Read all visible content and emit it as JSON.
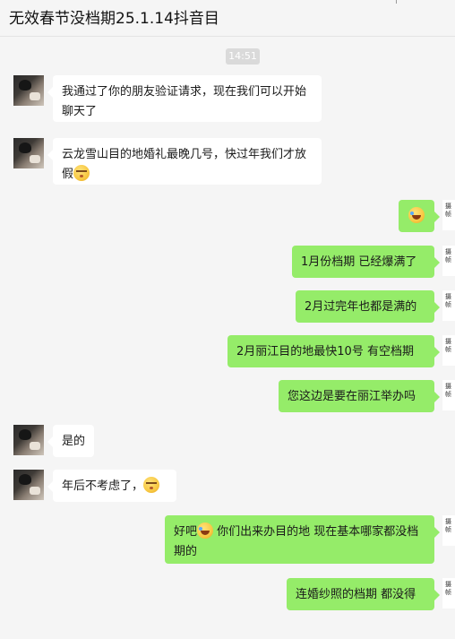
{
  "chat": {
    "title": "无效春节没档期25.1.14抖音目"
  },
  "timestamp": "14:51",
  "self_avatar_text": "摄\n帧",
  "messages": [
    {
      "side": "left",
      "text": "我通过了你的朋友验证请求，现在我们可以开始聊天了"
    },
    {
      "side": "left",
      "text": "云龙雪山目的地婚礼最晚几号，快过年我们才放假",
      "emoji": "shy"
    },
    {
      "side": "right",
      "emoji": "laugh"
    },
    {
      "side": "right",
      "text": "1月份档期 已经爆满了"
    },
    {
      "side": "right",
      "text": "2月过完年也都是满的"
    },
    {
      "side": "right",
      "text": "2月丽江目的地最快10号 有空档期"
    },
    {
      "side": "right",
      "text": "您这边是要在丽江举办吗"
    },
    {
      "side": "left",
      "text": "是的"
    },
    {
      "side": "left",
      "text": "年后不考虑了，",
      "emoji": "shy"
    },
    {
      "side": "right",
      "text_before": "好吧",
      "emoji": "laugh",
      "text_after": " 你们出来办目的地 现在基本哪家都没档期的"
    },
    {
      "side": "right",
      "text": "连婚纱照的档期 都没得"
    }
  ]
}
